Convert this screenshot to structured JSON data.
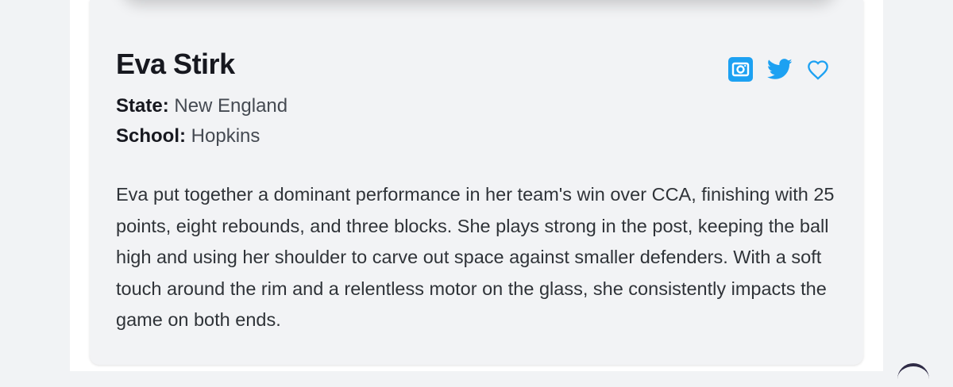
{
  "profile": {
    "name": "Eva Stirk",
    "state_label": "State:",
    "state_value": "New England",
    "school_label": "School:",
    "school_value": "Hopkins",
    "bio": "Eva put together a dominant performance in her team's win over CCA, finishing with 25 points, eight rebounds, and three blocks. She plays strong in the post, keeping the ball high and using her shoulder to carve out space against smaller defenders. With a soft touch around the rim and a relentless motor on the glass, she consistently impacts the game on both ends."
  },
  "social_icons": [
    {
      "icon": "instagram-icon",
      "color": "#1da1f2"
    },
    {
      "icon": "twitter-icon",
      "color": "#1da1f2"
    },
    {
      "icon": "heart-outline-icon",
      "color": "#1da1f2"
    }
  ],
  "colors": {
    "accent": "#1da1f2",
    "page_background": "#f1f3f5",
    "card_background": "#f2f3f5",
    "heading_text": "#17181f",
    "body_text": "#2f3338"
  }
}
